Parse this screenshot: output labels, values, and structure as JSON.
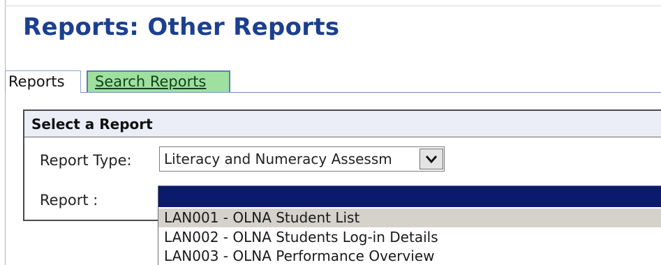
{
  "page": {
    "title": "Reports: Other Reports"
  },
  "tabs": [
    {
      "label": "Reports",
      "active": true
    },
    {
      "label": "Search Reports",
      "active": false
    }
  ],
  "panel": {
    "header": "Select a Report",
    "report_type_label": "Report Type:",
    "report_type_value": "Literacy and Numeracy Assessm",
    "report_label": "Report :",
    "report_options": [
      "",
      "LAN001 - OLNA Student List",
      "LAN002 - OLNA Students Log-in Details",
      "LAN003 - OLNA Performance Overview"
    ]
  },
  "colors": {
    "title": "#1c3f8f",
    "search_tab_bg": "#9fe0a0",
    "listbox_highlight": "#0b1a6c",
    "option_hover": "#d5d2cc",
    "panel_header_bg": "#ebedf7"
  },
  "icons": {
    "dropdown": "chevron-down-icon"
  }
}
